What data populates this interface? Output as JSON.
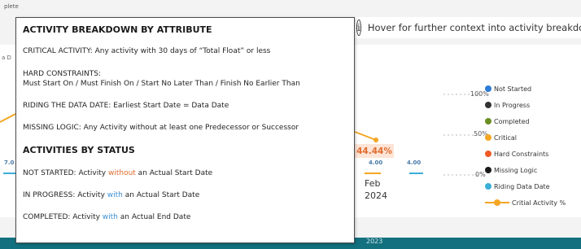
{
  "background": {
    "top_label": "plete",
    "side_label": "a D",
    "left_value": "7.0",
    "info_text": "Hover for further context into activity breakdown",
    "badge_pct": "44.44%",
    "values": [
      "4.00",
      "4.00"
    ],
    "x_month": "Feb",
    "x_year": "2024",
    "bottom_year": "2023",
    "y_ticks": [
      "100%",
      "50%",
      "0%"
    ]
  },
  "legend": {
    "items": [
      {
        "label": "Not Started",
        "color": "#2e7bd6"
      },
      {
        "label": "In Progress",
        "color": "#333333"
      },
      {
        "label": "Completed",
        "color": "#6b8e23"
      },
      {
        "label": "Critical",
        "color": "#f5a623"
      },
      {
        "label": "Hard Constraints",
        "color": "#f05a24"
      },
      {
        "label": "Missing Logic",
        "color": "#1a1a1a"
      },
      {
        "label": "Riding Data Date",
        "color": "#3aaed8"
      }
    ],
    "line_item": {
      "label": "Critial Activity %",
      "color": "#f5a623"
    }
  },
  "tooltip": {
    "heading1": "ACTIVITY BREAKDOWN BY ATTRIBUTE",
    "critical": "CRITICAL ACTIVITY:  Any activity with 30 days of “Total Float” or less",
    "hard_title": "HARD CONSTRAINTS:",
    "hard_body": "Must Start On / Must Finish On / Start No Later Than / Finish No Earlier Than",
    "riding": "RIDING THE DATA DATE: Earliest Start Date = Data Date",
    "missing": "MISSING LOGIC: Any Activity without at least one Predecessor or Successor",
    "heading2": "ACTIVITIES BY STATUS",
    "not_started_pre": "NOT STARTED: Activity ",
    "not_started_kw": "without",
    "not_started_post": " an Actual Start Date",
    "in_progress_pre": "IN PROGRESS: Activity ",
    "in_progress_kw": "with",
    "in_progress_post": " an Actual Start Date",
    "completed_pre": "COMPLETED: Activity ",
    "completed_kw": "with",
    "completed_post": " an Actual End Date"
  }
}
